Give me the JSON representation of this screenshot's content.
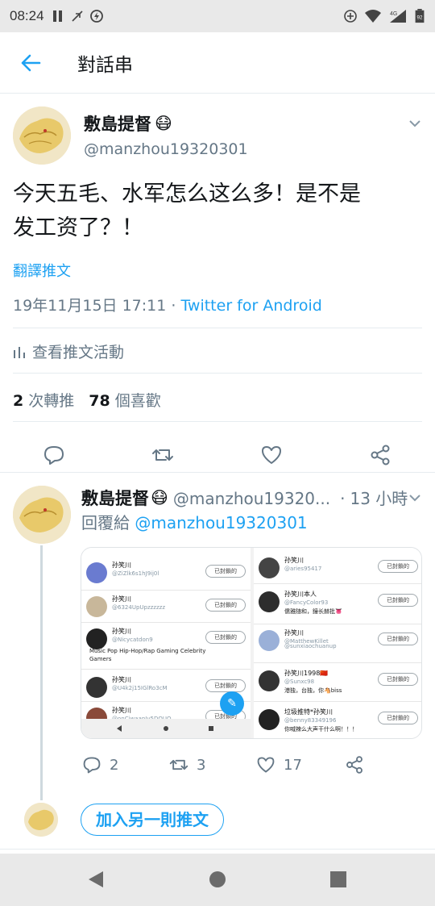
{
  "status_bar": {
    "time": "08:24",
    "battery": "92",
    "network": "4G"
  },
  "header": {
    "title": "對話串"
  },
  "main_tweet": {
    "name": "敷島提督",
    "name_emoji": "😷",
    "handle": "@manzhou19320301",
    "text_line1": "今天五毛、水军怎么这么多！是不是",
    "text_line2": "发工资了？！",
    "translate": "翻譯推文",
    "date": "19年11月15日 17:11 · ",
    "client": "Twitter for Android",
    "activity": "查看推文活動",
    "retweets_count": "2",
    "retweets_label": "次轉推",
    "likes_count": "78",
    "likes_label": "個喜歡"
  },
  "reply_tweet": {
    "name": "敷島提督",
    "name_emoji": "😷",
    "handle": "@manzhou19320...",
    "dot": "·",
    "time": "13 小時",
    "reply_prefix": "回覆給 ",
    "reply_to": "@manzhou19320301",
    "replies": "2",
    "retweets": "3",
    "likes": "17",
    "embedded_left": [
      {
        "name": "孙笑川",
        "handle": "@ZiZlk6s1hJ9ij0l",
        "extra": "",
        "button": "已封鎖的"
      },
      {
        "name": "孙笑川",
        "handle": "@6324UpUpzzzzzz",
        "extra": "",
        "button": "已封鎖的"
      },
      {
        "name": "孙笑川",
        "handle": "@Nicycatdon9",
        "extra": "Music Pop Hip-Hop/Rap Gaming Celebrity",
        "extra2": "Gamers",
        "button": "已封鎖的"
      },
      {
        "name": "孙笑川",
        "handle": "@U4k2j15IGlRo3cM",
        "extra": "",
        "button": "已封鎖的"
      },
      {
        "name": "孙笑川",
        "handle": "@onCiwaapJv5DOUQ",
        "extra": "",
        "button": "已封鎖的"
      }
    ],
    "embedded_right": [
      {
        "name": "孙笑川",
        "handle": "@aries95417",
        "extra": "",
        "button": "已封鎖的"
      },
      {
        "name": "孙笑川本人",
        "handle": "@FancyColor93",
        "extra": "儒雅随和，鐘长赫批👅",
        "button": "已封鎖的"
      },
      {
        "name": "孙笑川",
        "handle": "@MatthewKillet",
        "extra": "",
        "button": "已封鎖的"
      },
      {
        "name": "",
        "handle": "@sunxiaochuanup",
        "extra": "",
        "button": ""
      },
      {
        "name": "孙笑川1998🇨🇳",
        "handle": "@Sunxc98",
        "extra": "港独，台独，你🐴biss",
        "button": "已封鎖的"
      },
      {
        "name": "垃圾推特*孙笑川",
        "handle": "@benny83349196",
        "extra": "你喊辣么大声干什么啊！！！",
        "button": "已封鎖的"
      }
    ]
  },
  "add_tweet": {
    "label": "加入另一則推文"
  },
  "colors": {
    "accent": "#1da1f2",
    "muted": "#657786",
    "text": "#14171a"
  }
}
